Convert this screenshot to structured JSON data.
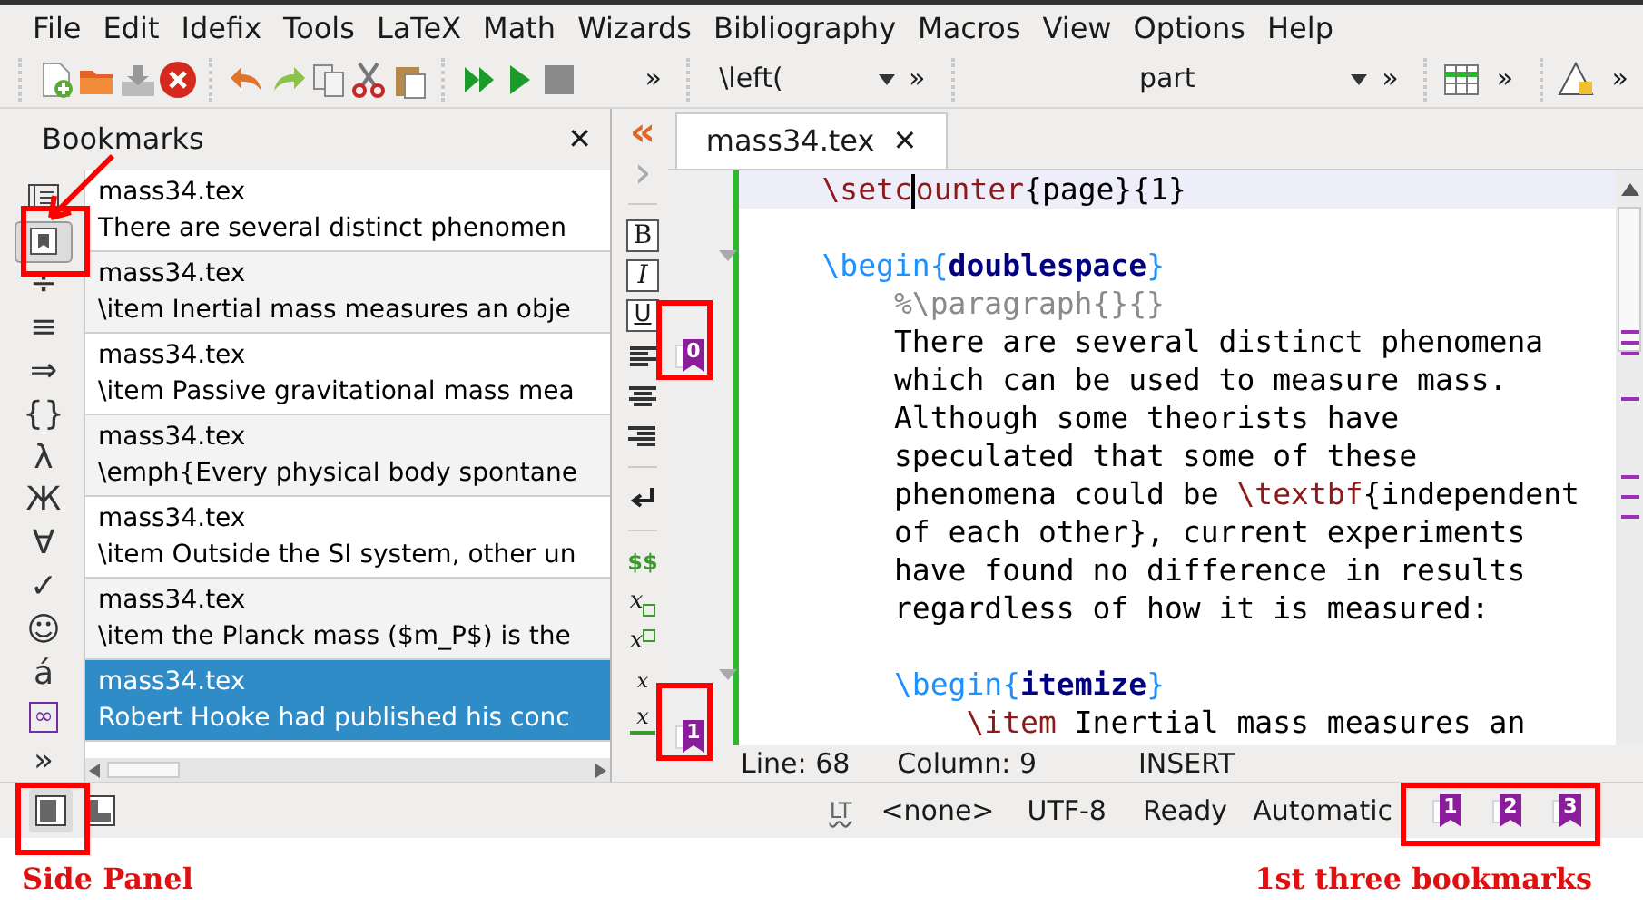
{
  "menu": [
    "File",
    "Edit",
    "Idefix",
    "Tools",
    "LaTeX",
    "Math",
    "Wizards",
    "Bibliography",
    "Macros",
    "View",
    "Options",
    "Help"
  ],
  "toolbar": {
    "more": "»",
    "left_combo": "\\left(",
    "structure_combo": "part"
  },
  "side_panel": {
    "title": "Bookmarks",
    "close": "✕",
    "tabs": [
      {
        "kind": "structure",
        "selected": false
      },
      {
        "kind": "bookmarks",
        "selected": true
      },
      {
        "kind": "glyph",
        "label": "÷",
        "selected": false
      },
      {
        "kind": "glyph",
        "label": "≡",
        "selected": false
      },
      {
        "kind": "glyph",
        "label": "⇒",
        "selected": false
      },
      {
        "kind": "glyph",
        "label": "{}",
        "selected": false
      },
      {
        "kind": "glyph",
        "label": "λ",
        "selected": false
      },
      {
        "kind": "glyph",
        "label": "Ж",
        "selected": false
      },
      {
        "kind": "glyph",
        "label": "∀",
        "selected": false
      },
      {
        "kind": "glyph",
        "label": "✓",
        "selected": false
      },
      {
        "kind": "glyph",
        "label": "☺",
        "selected": false
      },
      {
        "kind": "glyph",
        "label": "á",
        "selected": false
      },
      {
        "kind": "boxed",
        "label": "∞",
        "selected": false
      },
      {
        "kind": "glyph",
        "label": "»",
        "selected": false
      }
    ],
    "bookmarks": [
      {
        "file": "mass34.tex",
        "text": "There are several distinct phenomen",
        "selected": false
      },
      {
        "file": "mass34.tex",
        "text": "\\item Inertial mass measures an obje",
        "selected": false
      },
      {
        "file": "mass34.tex",
        "text": "\\item Passive gravitational mass mea",
        "selected": false
      },
      {
        "file": "mass34.tex",
        "text": "\\emph{Every physical body spontane",
        "selected": false
      },
      {
        "file": "mass34.tex",
        "text": "\\item Outside the SI system, other un",
        "selected": false
      },
      {
        "file": "mass34.tex",
        "text": "\\item the Planck mass ($m_P$) is the",
        "selected": false
      },
      {
        "file": "mass34.tex",
        "text": "Robert Hooke had published his conc",
        "selected": true
      }
    ]
  },
  "format_toolbar": [
    {
      "kind": "back",
      "label": "«"
    },
    {
      "kind": "forward",
      "label": "›"
    },
    {
      "kind": "separator"
    },
    {
      "kind": "bold",
      "label": "B"
    },
    {
      "kind": "italic",
      "label": "I"
    },
    {
      "kind": "underline",
      "label": "U"
    },
    {
      "kind": "align-left"
    },
    {
      "kind": "align-center"
    },
    {
      "kind": "align-right"
    },
    {
      "kind": "separator"
    },
    {
      "kind": "newline"
    },
    {
      "kind": "separator"
    },
    {
      "kind": "math",
      "label": "$$"
    },
    {
      "kind": "subscript",
      "label": "x"
    },
    {
      "kind": "superscript",
      "label": "x"
    },
    {
      "kind": "fraction",
      "label": "x"
    },
    {
      "kind": "strike",
      "label": "x"
    }
  ],
  "editor": {
    "tab": {
      "title": "mass34.tex",
      "close": "✕"
    },
    "lines": [
      {
        "current": true,
        "fold": false,
        "segments": [
          {
            "kind": "command",
            "text": "    \\setc"
          },
          {
            "kind": "cursor"
          },
          {
            "kind": "command",
            "text": "ounter"
          },
          {
            "kind": "plain",
            "text": "{page}{1}"
          }
        ]
      },
      {
        "current": false,
        "fold": false
      },
      {
        "current": false,
        "fold": true,
        "segments": [
          {
            "kind": "env",
            "text": "    \\begin{"
          },
          {
            "kind": "envname",
            "text": "doublespace"
          },
          {
            "kind": "env",
            "text": "}"
          }
        ]
      },
      {
        "current": false,
        "fold": false,
        "segments": [
          {
            "kind": "comment",
            "text": "        %\\paragraph{}{}"
          }
        ]
      },
      {
        "current": false,
        "fold": false,
        "bookmark": "0",
        "segments": [
          {
            "kind": "plain",
            "text": "        There are several distinct phenomena"
          }
        ]
      },
      {
        "current": false,
        "fold": false,
        "segments": [
          {
            "kind": "plain",
            "text": "        which can be used to measure mass."
          }
        ]
      },
      {
        "current": false,
        "fold": false,
        "segments": [
          {
            "kind": "plain",
            "text": "        Although some theorists have"
          }
        ]
      },
      {
        "current": false,
        "fold": false,
        "segments": [
          {
            "kind": "plain",
            "text": "        speculated that some of these"
          }
        ]
      },
      {
        "current": false,
        "fold": false,
        "segments": [
          {
            "kind": "plain",
            "text": "        phenomena could be "
          },
          {
            "kind": "command",
            "text": "\\textbf"
          },
          {
            "kind": "plain",
            "text": "{independent"
          }
        ]
      },
      {
        "current": false,
        "fold": false,
        "segments": [
          {
            "kind": "plain",
            "text": "        of each other}, current experiments"
          }
        ]
      },
      {
        "current": false,
        "fold": false,
        "segments": [
          {
            "kind": "plain",
            "text": "        have found no difference in results"
          }
        ]
      },
      {
        "current": false,
        "fold": false,
        "segments": [
          {
            "kind": "plain",
            "text": "        regardless of how it is measured:"
          }
        ]
      },
      {
        "current": false,
        "fold": false
      },
      {
        "current": false,
        "fold": true,
        "segments": [
          {
            "kind": "env",
            "text": "        \\begin{"
          },
          {
            "kind": "envname",
            "text": "itemize"
          },
          {
            "kind": "env",
            "text": "}"
          }
        ]
      },
      {
        "current": false,
        "fold": false,
        "bookmark": "1",
        "segments": [
          {
            "kind": "command",
            "text": "            \\item"
          },
          {
            "kind": "plain",
            "text": " Inertial mass measures an"
          }
        ]
      }
    ],
    "position": {
      "line": "Line: 68",
      "column": "Column: 9",
      "mode": "INSERT"
    }
  },
  "status_bar": {
    "grammar": "LT",
    "language": "<none>",
    "encoding": "UTF-8",
    "state": "Ready",
    "compile": "Automatic",
    "bookmarks": [
      "1",
      "2",
      "3"
    ]
  },
  "annotations": {
    "side_panel": "Side Panel",
    "bookmarks": "1st three bookmarks"
  }
}
